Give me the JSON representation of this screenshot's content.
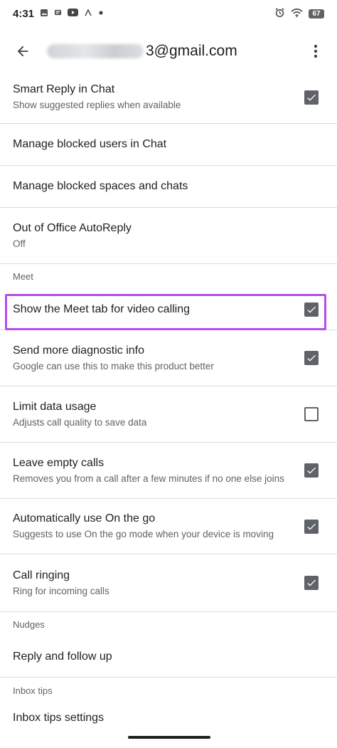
{
  "status_bar": {
    "time": "4:31",
    "left_icons": [
      "image-icon",
      "notification-icon",
      "youtube-icon",
      "network-icon",
      "dot-icon"
    ],
    "right_icons": [
      "alarm-icon",
      "wifi-icon"
    ],
    "battery": "67"
  },
  "app_bar": {
    "account_suffix": "3@gmail.com",
    "back_icon": "arrow-back-icon",
    "more_icon": "more-vert-icon"
  },
  "settings": {
    "smart_reply": {
      "title": "Smart Reply in Chat",
      "subtitle": "Show suggested replies when available",
      "checked": true
    },
    "blocked_users": {
      "title": "Manage blocked users in Chat"
    },
    "blocked_spaces": {
      "title": "Manage blocked spaces and chats"
    },
    "ooo": {
      "title": "Out of Office AutoReply",
      "subtitle": "Off"
    },
    "meet_header": "Meet",
    "meet_tab": {
      "title": "Show the Meet tab for video calling",
      "checked": true
    },
    "diagnostic": {
      "title": "Send more diagnostic info",
      "subtitle": "Google can use this to make this product better",
      "checked": true
    },
    "limit_data": {
      "title": "Limit data usage",
      "subtitle": "Adjusts call quality to save data",
      "checked": false
    },
    "leave_empty": {
      "title": "Leave empty calls",
      "subtitle": "Removes you from a call after a few minutes if no one else joins",
      "checked": true
    },
    "on_the_go": {
      "title": "Automatically use On the go",
      "subtitle": "Suggests to use On the go mode when your device is moving",
      "checked": true
    },
    "call_ringing": {
      "title": "Call ringing",
      "subtitle": "Ring for incoming calls",
      "checked": true
    },
    "nudges_header": "Nudges",
    "reply_follow": {
      "title": "Reply and follow up"
    },
    "inbox_tips_header": "Inbox tips",
    "inbox_tips_settings": {
      "title": "Inbox tips settings"
    }
  },
  "colors": {
    "checkbox": "#5f6368",
    "highlight": "#b44cf0",
    "divider": "#dadce0"
  }
}
